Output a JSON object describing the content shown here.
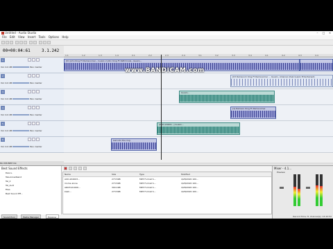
{
  "window": {
    "title": "Untitled - Audio Studio"
  },
  "menu": [
    "File",
    "Edit",
    "View",
    "Insert",
    "Tools",
    "Options",
    "Help"
  ],
  "transport_top": {
    "time": "00+00:04:61",
    "tempo": "3.1.242"
  },
  "ruler_marks": [
    "1.1",
    "1.2",
    "1.3",
    "1.4",
    "2.1",
    "2.2",
    "2.3",
    "2.4",
    "3.1",
    "3.2",
    "3.3",
    "3.4",
    "4.1",
    "4.2",
    "4.3",
    "4.4"
  ],
  "tracks": [
    {
      "num": "1",
      "vol": "Vol: 0.0 dB",
      "pan": "Pan: Center"
    },
    {
      "num": "2",
      "vol": "Vol: 0.0 dB",
      "pan": "Pan: Center"
    },
    {
      "num": "3",
      "vol": "Vol: 0.0 dB",
      "pan": "Pan: Center"
    },
    {
      "num": "4",
      "vol": "Vol: 0.0 dB",
      "pan": "Pan: Center"
    },
    {
      "num": "5",
      "vol": "Vol: 0.0 dB",
      "pan": "Pan: Center"
    },
    {
      "num": "6",
      "vol": "Vol: 0.0 dB",
      "pan": "Pan: Center"
    }
  ],
  "clips": [
    {
      "label": "[01 John King Ft Ramsoomer... Guazo 2 John King Ft Rafiminals...Guazo...",
      "lane": 0
    },
    {
      "label": "[03 Ramsoom King Ft Ramsoomer ... Guazo...Ghanian Zeal Guazo Entertained]",
      "lane": 1
    },
    {
      "label": "Guazo...",
      "lane": 2
    },
    {
      "label": "[1] Ramson King Ft Ramsoomer",
      "lane": 3
    },
    {
      "label": "[AUD-20200...] Guazo...",
      "lane": 4
    },
    {
      "label": "Get into the ring",
      "lane": 5
    }
  ],
  "bottom_left": {
    "zoom": "80.358",
    "bpm": "BPM",
    "vol": "Vol:"
  },
  "browser": {
    "title": "Best Sound Effects",
    "nodes": [
      "Desc+",
      "Tele-broadband",
      "Tel_2",
      "Tel_Audi",
      "Files",
      "Best Sound Eff..."
    ]
  },
  "files": {
    "headers": [
      "Name",
      "Size",
      "Type",
      "Modified"
    ],
    "rows": [
      {
        "name": "AUD-202003...",
        "size": "273.5KB",
        "type": "MP3 Format S...",
        "mod": "4/28/2020 100..."
      },
      {
        "name": "mome alone",
        "size": "273.5KB",
        "type": "MP3 Format S...",
        "mod": "4/28/2020 100..."
      },
      {
        "name": "ARCH121009...",
        "size": "300.1KB",
        "type": "MP3 Format S...",
        "mod": "4/28/2020 100..."
      },
      {
        "name": "kaali...",
        "size": "273.5KB",
        "type": "MP3 Format S...",
        "mod": "4/28/2020 100..."
      }
    ]
  },
  "mixer": {
    "title": "Mixer - 4.1...",
    "preview": "Preview"
  },
  "tabs": [
    "Sound Pool",
    "Media Manager",
    "Explorer"
  ],
  "status": "Record Time 71 channel(s): 13:43:52",
  "watermark": "www.BANDICAM.com"
}
